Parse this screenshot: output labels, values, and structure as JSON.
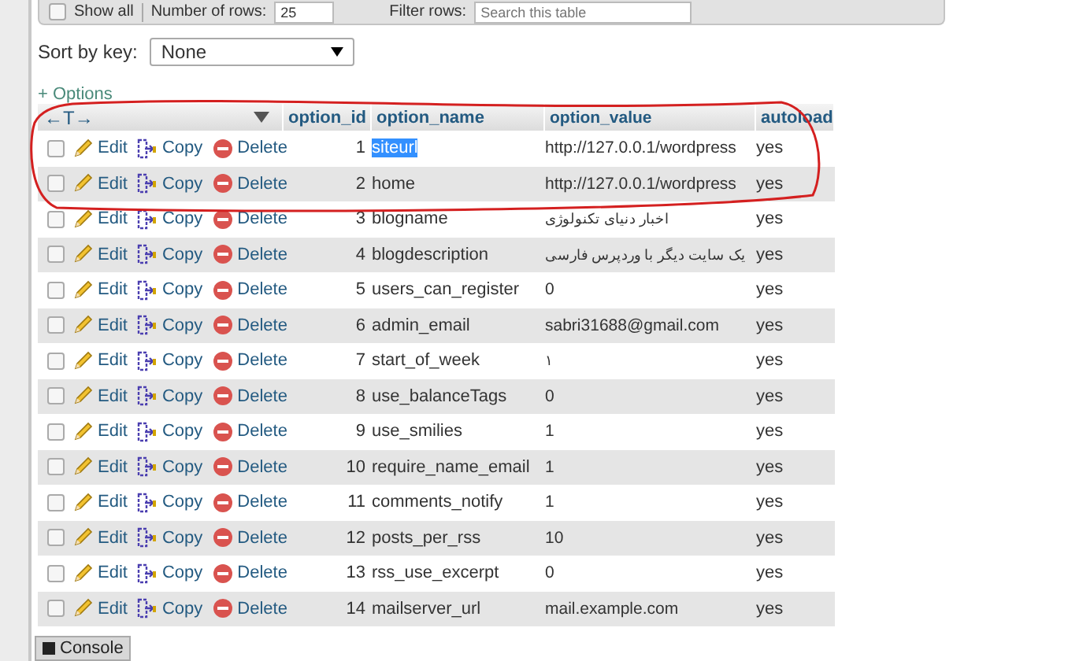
{
  "toolbar": {
    "show_all": {
      "label": "Show all",
      "checked": false
    },
    "rows_label": "Number of rows:",
    "rows_value": "25",
    "filter_label": "Filter rows:",
    "filter_placeholder": "Search this table"
  },
  "sort": {
    "label": "Sort by key:",
    "value": "None"
  },
  "options_link": "+ Options",
  "table": {
    "column_arrows": "←T→",
    "columns": [
      "option_id",
      "option_name",
      "option_value",
      "autoload"
    ],
    "rows": [
      {
        "checked": false,
        "edit": "Edit",
        "copy": "Copy",
        "delete": "Delete",
        "id": "1",
        "name": "siteurl",
        "name_selected": true,
        "value": "http://127.0.0.1/wordpress",
        "autoload": "yes"
      },
      {
        "checked": false,
        "edit": "Edit",
        "copy": "Copy",
        "delete": "Delete",
        "id": "2",
        "name": "home",
        "name_selected": false,
        "value": "http://127.0.0.1/wordpress",
        "autoload": "yes"
      },
      {
        "checked": false,
        "edit": "Edit",
        "copy": "Copy",
        "delete": "Delete",
        "id": "3",
        "name": "blogname",
        "name_selected": false,
        "value": "اخبار دنیای تکنولوژی",
        "autoload": "yes"
      },
      {
        "checked": false,
        "edit": "Edit",
        "copy": "Copy",
        "delete": "Delete",
        "id": "4",
        "name": "blogdescription",
        "name_selected": false,
        "value": "یک سایت دیگر با وردپرس فارسی",
        "autoload": "yes"
      },
      {
        "checked": false,
        "edit": "Edit",
        "copy": "Copy",
        "delete": "Delete",
        "id": "5",
        "name": "users_can_register",
        "name_selected": false,
        "value": "0",
        "autoload": "yes"
      },
      {
        "checked": false,
        "edit": "Edit",
        "copy": "Copy",
        "delete": "Delete",
        "id": "6",
        "name": "admin_email",
        "name_selected": false,
        "value": "sabri31688@gmail.com",
        "autoload": "yes"
      },
      {
        "checked": false,
        "edit": "Edit",
        "copy": "Copy",
        "delete": "Delete",
        "id": "7",
        "name": "start_of_week",
        "name_selected": false,
        "value": "۱",
        "autoload": "yes"
      },
      {
        "checked": false,
        "edit": "Edit",
        "copy": "Copy",
        "delete": "Delete",
        "id": "8",
        "name": "use_balanceTags",
        "name_selected": false,
        "value": "0",
        "autoload": "yes"
      },
      {
        "checked": false,
        "edit": "Edit",
        "copy": "Copy",
        "delete": "Delete",
        "id": "9",
        "name": "use_smilies",
        "name_selected": false,
        "value": "1",
        "autoload": "yes"
      },
      {
        "checked": false,
        "edit": "Edit",
        "copy": "Copy",
        "delete": "Delete",
        "id": "10",
        "name": "require_name_email",
        "name_selected": false,
        "value": "1",
        "autoload": "yes"
      },
      {
        "checked": false,
        "edit": "Edit",
        "copy": "Copy",
        "delete": "Delete",
        "id": "11",
        "name": "comments_notify",
        "name_selected": false,
        "value": "1",
        "autoload": "yes"
      },
      {
        "checked": false,
        "edit": "Edit",
        "copy": "Copy",
        "delete": "Delete",
        "id": "12",
        "name": "posts_per_rss",
        "name_selected": false,
        "value": "10",
        "autoload": "yes"
      },
      {
        "checked": false,
        "edit": "Edit",
        "copy": "Copy",
        "delete": "Delete",
        "id": "13",
        "name": "rss_use_excerpt",
        "name_selected": false,
        "value": "0",
        "autoload": "yes"
      },
      {
        "checked": false,
        "edit": "Edit",
        "copy": "Copy",
        "delete": "Delete",
        "id": "14",
        "name": "mailserver_url",
        "name_selected": false,
        "value": "mail.example.com",
        "autoload": "yes"
      }
    ]
  },
  "console": {
    "label": "Console"
  }
}
